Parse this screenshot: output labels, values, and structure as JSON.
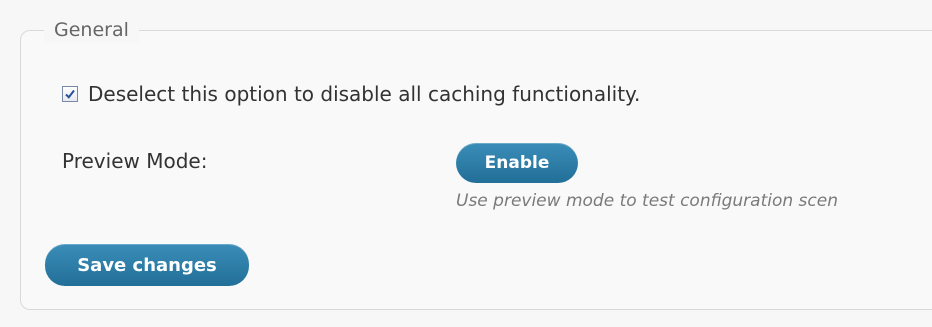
{
  "fieldset": {
    "legend": "General"
  },
  "caching": {
    "checked": true,
    "label": "Deselect this option to disable all caching functionality."
  },
  "preview": {
    "label": "Preview Mode:",
    "button_label": "Enable",
    "hint": "Use preview mode to test configuration scen"
  },
  "actions": {
    "save_label": "Save changes"
  },
  "colors": {
    "button": "#2a7fab",
    "checkmark": "#2b4f9a"
  }
}
